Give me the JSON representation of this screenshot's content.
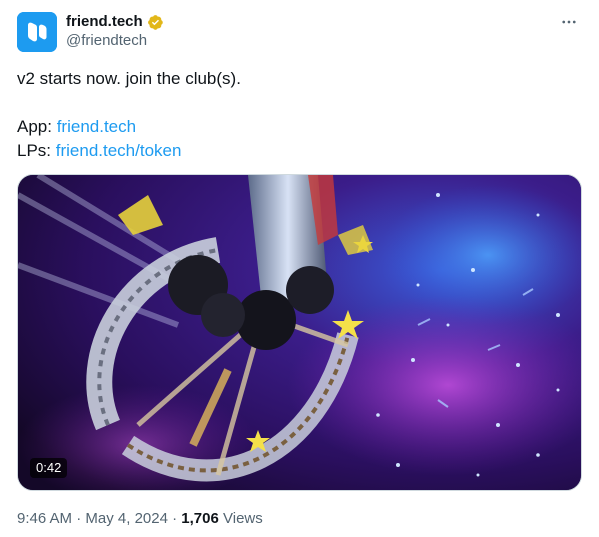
{
  "author": {
    "display_name": "friend.tech",
    "handle": "@friendtech",
    "avatar_icon": "friendtech-logo-icon",
    "verified_icon": "verified-gold-badge-icon",
    "colors": {
      "avatar_bg": "#1d9bf0",
      "verified": "#e2b719"
    }
  },
  "more_icon": "more-horizontal-icon",
  "text": {
    "line1": "v2 starts now. join the club(s).",
    "app_label": "App: ",
    "app_link": "friend.tech",
    "lps_label": "LPs: ",
    "lps_link": "friend.tech/token"
  },
  "media": {
    "type": "video",
    "duration": "0:42"
  },
  "meta": {
    "time": "9:46 AM",
    "sep1": " · ",
    "date": "May 4, 2024",
    "sep2": " · ",
    "views_count": "1,706",
    "views_label": " Views"
  },
  "colors": {
    "link": "#1d9bf0",
    "secondary_text": "#536471",
    "primary_text": "#0f1419"
  }
}
